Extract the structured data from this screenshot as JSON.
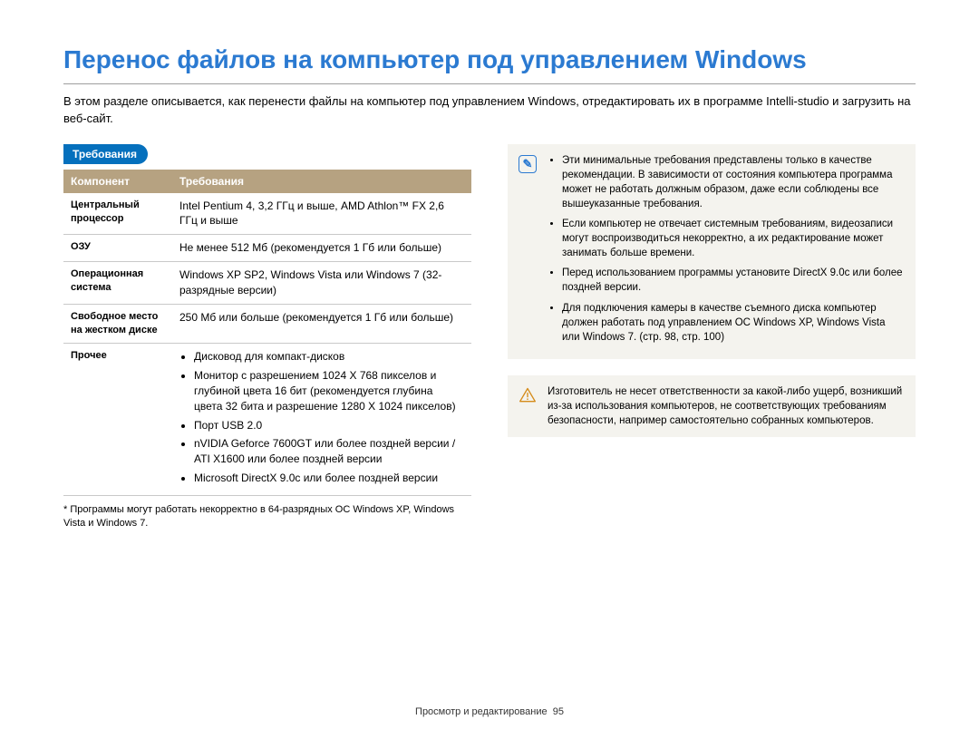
{
  "title": "Перенос файлов на компьютер под управлением Windows",
  "intro": "В этом разделе описывается, как перенести файлы на компьютер под управлением Windows, отредактировать их в программе Intelli-studio и загрузить на веб-сайт.",
  "section_label": "Требования",
  "table": {
    "header_component": "Компонент",
    "header_requirements": "Требования",
    "rows": {
      "cpu_label": "Центральный процессор",
      "cpu_value": "Intel Pentium 4, 3,2 ГГц и выше, AMD Athlon™ FX 2,6 ГГц и выше",
      "ram_label": "ОЗУ",
      "ram_value": "Не менее 512 Мб (рекомендуется 1 Гб или больше)",
      "os_label": "Операционная система",
      "os_value": "Windows XP SP2, Windows Vista или Windows 7 (32-разрядные версии)",
      "disk_label": "Свободное место на жестком диске",
      "disk_value": "250 Мб или больше (рекомендуется 1 Гб или больше)",
      "other_label": "Прочее",
      "other_items": {
        "i0": "Дисковод для компакт-дисков",
        "i1": "Монитор с разрешением 1024 X 768 пикселов и глубиной цвета 16 бит (рекомендуется глубина цвета 32 бита и разрешение 1280 X 1024 пикселов)",
        "i2": "Порт USB 2.0",
        "i3": "nVIDIA Geforce 7600GT или более поздней версии / ATI X1600 или более поздней версии",
        "i4": "Microsoft DirectX 9.0c или более поздней версии"
      }
    }
  },
  "footnote": "* Программы могут работать некорректно в 64-разрядных ОС Windows XP, Windows Vista и Windows 7.",
  "info_notes": {
    "n0": "Эти минимальные требования представлены только в качестве рекомендации. В зависимости от состояния компьютера программа может не работать должным образом, даже если соблюдены все вышеуказанные требования.",
    "n1": "Если компьютер не отвечает системным требованиям, видеозаписи могут воспроизводиться некорректно, а их редактирование может занимать больше времени.",
    "n2": "Перед использованием программы установите DirectX 9.0c или более поздней версии.",
    "n3": "Для подключения камеры в качестве съемного диска компьютер должен работать под управлением ОС Windows XP, Windows Vista или Windows 7. (стр. 98, стр. 100)"
  },
  "warning_text": "Изготовитель не несет ответственности за какой-либо ущерб, возникший из-за использования компьютеров, не соответствующих требованиям безопасности, например самостоятельно собранных компьютеров.",
  "footer_section": "Просмотр и редактирование",
  "footer_page": "95"
}
